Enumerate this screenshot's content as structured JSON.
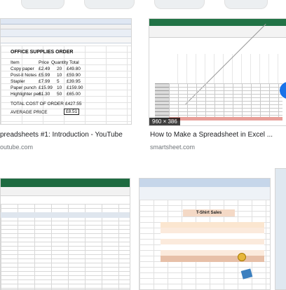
{
  "results": [
    {
      "caption": "preadsheets #1: Introduction - YouTube",
      "source": "outube.com",
      "sheet": {
        "heading": "OFFICE SUPPLIES ORDER",
        "columns": [
          "Item",
          "Price",
          "Quantity",
          "Total"
        ],
        "rows": [
          {
            "item": "Copy paper",
            "price": "£2.49",
            "qty": "20",
            "total": "£49.80"
          },
          {
            "item": "Post-it Notes",
            "price": "£5.99",
            "qty": "10",
            "total": "£59.90"
          },
          {
            "item": "Stapler",
            "price": "£7.99",
            "qty": "5",
            "total": "£39.95"
          },
          {
            "item": "Paper punch",
            "price": "£15.99",
            "qty": "10",
            "total": "£159.90"
          },
          {
            "item": "Highlighter pen",
            "price": "£1.30",
            "qty": "50",
            "total": "£65.00"
          }
        ],
        "total_label": "TOTAL COST OF ORDER",
        "total_value": "£427.55",
        "avg_label": "AVERAGE PRICE",
        "avg_value": "£8.51"
      }
    },
    {
      "caption": "How to Make a Spreadsheet in Excel ...",
      "source": "smartsheet.com",
      "badge": "960 × 386"
    },
    {
      "caption": "",
      "source": ""
    },
    {
      "caption": "",
      "source": "",
      "sheet_title": "T-Shirt Sales"
    }
  ],
  "colors": {
    "excel_green": "#217346",
    "accent_blue": "#1a73e8"
  }
}
